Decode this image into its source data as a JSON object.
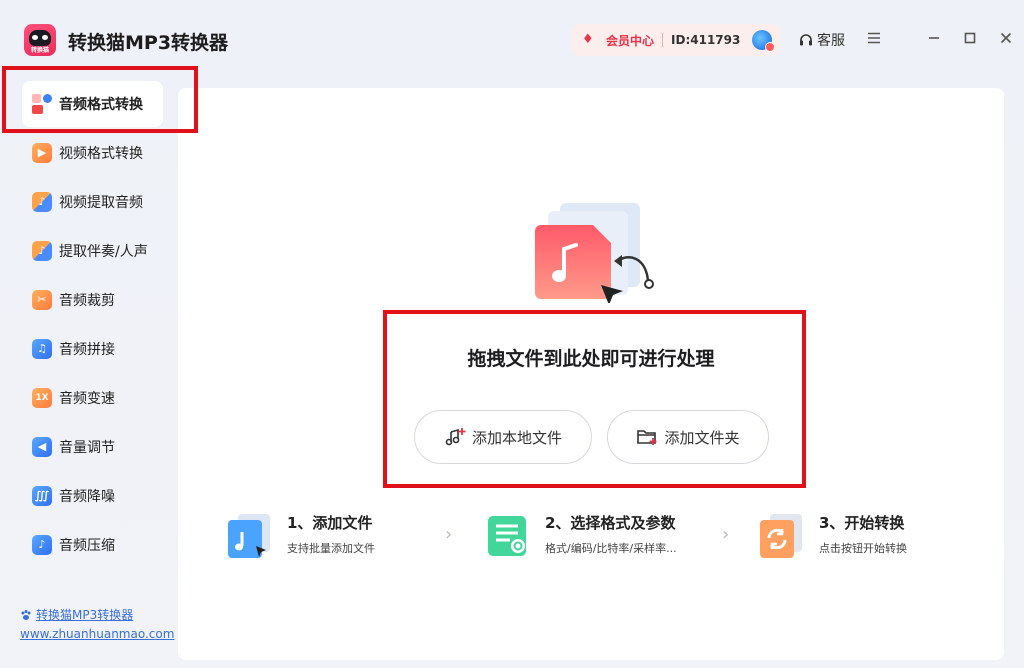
{
  "app": {
    "title": "转换猫MP3转换器",
    "logo_text": "转换猫"
  },
  "header": {
    "member_center": "会员中心",
    "user_id": "ID:411793",
    "support": "客服"
  },
  "sidebar": {
    "items": [
      {
        "label": "音频格式转换",
        "icon": "audio-format-icon",
        "active": true
      },
      {
        "label": "视频格式转换",
        "icon": "video-play-icon"
      },
      {
        "label": "视频提取音频",
        "icon": "video-audio-icon"
      },
      {
        "label": "提取伴奏/人声",
        "icon": "vocal-icon"
      },
      {
        "label": "音频裁剪",
        "icon": "scissors-icon"
      },
      {
        "label": "音频拼接",
        "icon": "join-icon"
      },
      {
        "label": "音频变速",
        "icon": "speed-icon",
        "glyph": "1X"
      },
      {
        "label": "音量调节",
        "icon": "volume-icon"
      },
      {
        "label": "音频降噪",
        "icon": "noise-icon"
      },
      {
        "label": "音频压缩",
        "icon": "compress-icon"
      }
    ],
    "footer_link": "转换猫MP3转换器",
    "footer_url": "www.zhuanhuanmao.com"
  },
  "main": {
    "drop_title": "拖拽文件到此处即可进行处理",
    "add_local_file": "添加本地文件",
    "add_folder": "添加文件夹",
    "steps": [
      {
        "title": "1、添加文件",
        "desc": "支持批量添加文件"
      },
      {
        "title": "2、选择格式及参数",
        "desc": "格式/编码/比特率/采样率..."
      },
      {
        "title": "3、开始转换",
        "desc": "点击按钮开始转换"
      }
    ]
  },
  "colors": {
    "accent_red": "#e0111a",
    "member_red": "#e8334a",
    "link_blue": "#3a6fd8"
  }
}
